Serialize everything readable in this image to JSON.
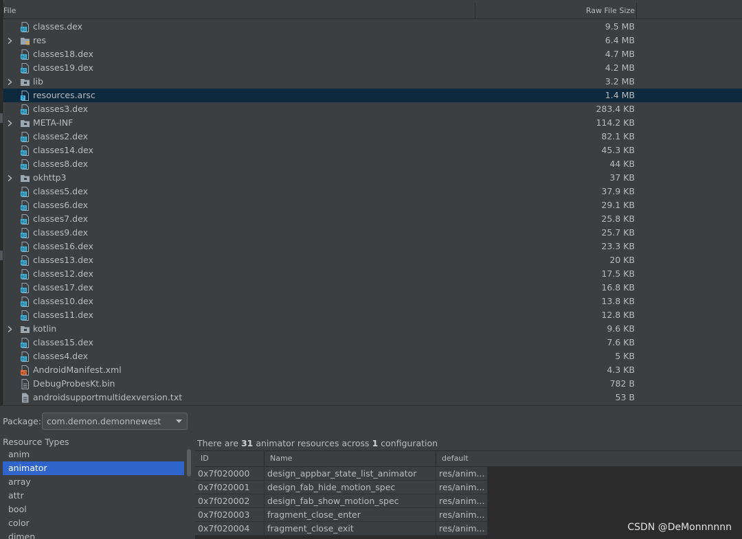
{
  "file_table": {
    "columns": {
      "file": "File",
      "raw_file_size": "Raw File Size"
    },
    "rows": [
      {
        "name": "classes.dex",
        "size": "9.5 MB",
        "icon": "dex-file-icon",
        "expandable": false
      },
      {
        "name": "res",
        "size": "6.4 MB",
        "icon": "resource-folder-icon",
        "expandable": true
      },
      {
        "name": "classes18.dex",
        "size": "4.7 MB",
        "icon": "dex-file-icon",
        "expandable": false
      },
      {
        "name": "classes19.dex",
        "size": "4.2 MB",
        "icon": "dex-file-icon",
        "expandable": false
      },
      {
        "name": "lib",
        "size": "3.2 MB",
        "icon": "folder-icon",
        "expandable": true
      },
      {
        "name": "resources.arsc",
        "size": "1.4 MB",
        "icon": "unknown-file-icon",
        "expandable": false,
        "selected": true
      },
      {
        "name": "classes3.dex",
        "size": "283.4 KB",
        "icon": "dex-file-icon",
        "expandable": false
      },
      {
        "name": "META-INF",
        "size": "114.2 KB",
        "icon": "folder-icon",
        "expandable": true
      },
      {
        "name": "classes2.dex",
        "size": "82.1 KB",
        "icon": "dex-file-icon",
        "expandable": false
      },
      {
        "name": "classes14.dex",
        "size": "45.3 KB",
        "icon": "dex-file-icon",
        "expandable": false
      },
      {
        "name": "classes8.dex",
        "size": "44 KB",
        "icon": "dex-file-icon",
        "expandable": false
      },
      {
        "name": "okhttp3",
        "size": "37 KB",
        "icon": "folder-icon",
        "expandable": true
      },
      {
        "name": "classes5.dex",
        "size": "37.9 KB",
        "icon": "dex-file-icon",
        "expandable": false
      },
      {
        "name": "classes6.dex",
        "size": "29.1 KB",
        "icon": "dex-file-icon",
        "expandable": false
      },
      {
        "name": "classes7.dex",
        "size": "25.8 KB",
        "icon": "dex-file-icon",
        "expandable": false
      },
      {
        "name": "classes9.dex",
        "size": "25.7 KB",
        "icon": "dex-file-icon",
        "expandable": false
      },
      {
        "name": "classes16.dex",
        "size": "23.3 KB",
        "icon": "dex-file-icon",
        "expandable": false
      },
      {
        "name": "classes13.dex",
        "size": "20 KB",
        "icon": "dex-file-icon",
        "expandable": false
      },
      {
        "name": "classes12.dex",
        "size": "17.5 KB",
        "icon": "dex-file-icon",
        "expandable": false
      },
      {
        "name": "classes17.dex",
        "size": "16.8 KB",
        "icon": "dex-file-icon",
        "expandable": false
      },
      {
        "name": "classes10.dex",
        "size": "13.8 KB",
        "icon": "dex-file-icon",
        "expandable": false
      },
      {
        "name": "classes11.dex",
        "size": "12.8 KB",
        "icon": "dex-file-icon",
        "expandable": false
      },
      {
        "name": "kotlin",
        "size": "9.6 KB",
        "icon": "folder-icon",
        "expandable": true
      },
      {
        "name": "classes15.dex",
        "size": "7.6 KB",
        "icon": "dex-file-icon",
        "expandable": false
      },
      {
        "name": "classes4.dex",
        "size": "5 KB",
        "icon": "dex-file-icon",
        "expandable": false
      },
      {
        "name": "AndroidManifest.xml",
        "size": "4.3 KB",
        "icon": "xml-file-icon",
        "expandable": false
      },
      {
        "name": "DebugProbesKt.bin",
        "size": "782 B",
        "icon": "binary-file-icon",
        "expandable": false
      },
      {
        "name": "androidsupportmultidexversion.txt",
        "size": "53 B",
        "icon": "text-file-icon",
        "expandable": false
      }
    ]
  },
  "package": {
    "label": "Package:",
    "selected": "com.demon.demonnewest"
  },
  "resource_types": {
    "title": "Resource Types",
    "items": [
      "anim",
      "animator",
      "array",
      "attr",
      "bool",
      "color",
      "dimen"
    ],
    "selected": "animator"
  },
  "resources": {
    "summary": {
      "prefix": "There are ",
      "count": "31",
      "middle": " animator resources across ",
      "config_count": "1",
      "suffix": " configuration"
    },
    "columns": {
      "id": "ID",
      "name": "Name",
      "default": "default"
    },
    "rows": [
      {
        "id": "0x7f020000",
        "name": "design_appbar_state_list_animator",
        "default": "res/anim..."
      },
      {
        "id": "0x7f020001",
        "name": "design_fab_hide_motion_spec",
        "default": "res/anim..."
      },
      {
        "id": "0x7f020002",
        "name": "design_fab_show_motion_spec",
        "default": "res/anim..."
      },
      {
        "id": "0x7f020003",
        "name": "fragment_close_enter",
        "default": "res/anim..."
      },
      {
        "id": "0x7f020004",
        "name": "fragment_close_exit",
        "default": "res/anim..."
      }
    ]
  },
  "watermark": "CSDN @DeMonnnnnn",
  "colors": {
    "background": "#3c3f41",
    "selected_row": "#0d293e",
    "selected_list_item": "#2f65ca",
    "text": "#bbbbbb"
  }
}
